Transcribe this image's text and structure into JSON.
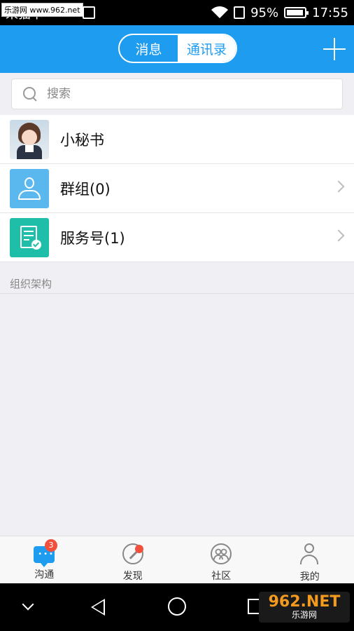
{
  "status_bar": {
    "carrier": "来猫卡",
    "watermark": "乐游网 www.962.net",
    "battery": "95%",
    "time": "17:55"
  },
  "header": {
    "segments": [
      {
        "label": "消息",
        "active": false
      },
      {
        "label": "通讯录",
        "active": true
      }
    ],
    "add_icon": "plus-icon"
  },
  "search": {
    "placeholder": "搜索"
  },
  "contacts": [
    {
      "label": "小秘书",
      "icon": "secretary-avatar",
      "chevron": false
    },
    {
      "label": "群组(0)",
      "icon": "group-icon",
      "chevron": true
    },
    {
      "label": "服务号(1)",
      "icon": "service-icon",
      "chevron": true
    }
  ],
  "section": {
    "title": "组织架构"
  },
  "tabbar": {
    "items": [
      {
        "label": "沟通",
        "icon": "chat-icon",
        "badge": "3"
      },
      {
        "label": "发现",
        "icon": "compass-icon",
        "dot": true
      },
      {
        "label": "社区",
        "icon": "community-icon"
      },
      {
        "label": "我的",
        "icon": "person-icon"
      }
    ]
  },
  "watermark_bottom": {
    "big": "962.NET",
    "small": "乐游网"
  },
  "colors": {
    "primary": "#1e9cf0",
    "badge": "#f0503c",
    "group": "#5bb8ef",
    "service": "#1fbea8"
  }
}
